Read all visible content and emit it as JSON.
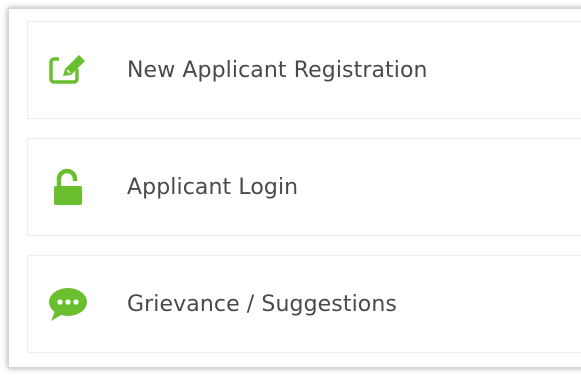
{
  "accent_color": "#6abf2e",
  "menu": {
    "items": [
      {
        "label": "New Applicant Registration",
        "icon": "edit-icon"
      },
      {
        "label": "Applicant Login",
        "icon": "unlock-icon"
      },
      {
        "label": "Grievance / Suggestions",
        "icon": "chat-bubble-icon"
      }
    ]
  }
}
